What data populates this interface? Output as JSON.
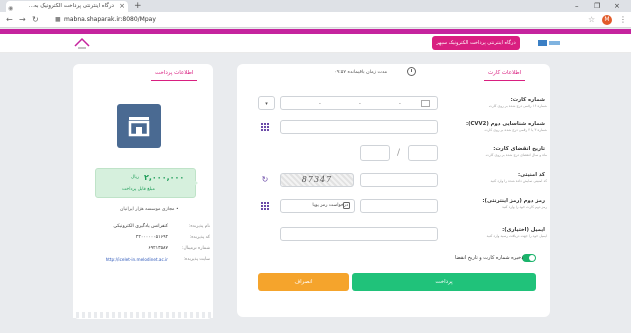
{
  "browser": {
    "tab_title": "درگاه اینترنتی پرداخت الکترونیک به...",
    "tab_close": "×",
    "new_tab": "+",
    "url": "mabna.shaparak.ir:8080/Mpay",
    "window_min": "–",
    "window_max": "❐",
    "window_close": "×",
    "profile_initial": "M"
  },
  "header": {
    "title": "درگاه اینترنتی پرداخت الکترونیک سپهر"
  },
  "card_panel": {
    "tab_label": "اطلاعات کارت",
    "timer_label": "مدت زمان باقیمانده",
    "timer_value": "۰۹:۵۷",
    "card_number": {
      "label": "شماره کارت:",
      "hint": "شماره ۱۶ رقمی درج شده بر روی کارت",
      "dash1": "-",
      "dash2": "-",
      "dash3": "-"
    },
    "cvv2": {
      "label": "شماره شناسایی دوم (CVV2):",
      "hint": "شماره ۳ یا ۴ رقمی درج شده بر روی کارت"
    },
    "expiry": {
      "label": "تاریخ انقضای کارت:",
      "hint": "ماه و سال انقضای درج شده بر روی کارت",
      "separator": "/"
    },
    "captcha": {
      "label": "کد امنیتی:",
      "hint": "کد امنیتی نمایش داده شده را وارد کنید",
      "code": "87347"
    },
    "password": {
      "label": "رمز دوم (رمز اینترنتی):",
      "hint": "رمز دوم کارت خود را وارد کنید",
      "request_button": "درخواست رمز پویا"
    },
    "email": {
      "label": "ایمیل (اختیاری):",
      "hint": "ایمیل خود را جهت دریافت رسید وارد کنید"
    },
    "save_label": "ذخیره شماره کارت و تاریخ انقضا",
    "pay_button": "پرداخت",
    "cancel_button": "انصراف"
  },
  "info_panel": {
    "tab_label": "اطلاعات پرداخت",
    "amount": "۲,۰۰۰,۰۰۰",
    "amount_unit": "ریال",
    "amount_label": "مبلغ قابل پرداخت",
    "detail_heading": "• مجازی موسسه هژار ایرانیان",
    "details": [
      {
        "label": "نام پذیرنده:",
        "value": "کنفرانس یادگیری الکترونیکی"
      },
      {
        "label": "کد پذیرنده:",
        "value": "۲۲۰۰۰۰۰۰۵۱۶۹۲"
      },
      {
        "label": "شماره ترمینال:",
        "value": "۶۹۲۱۳۵۸۷"
      },
      {
        "label": "سایت پذیرنده:",
        "value": "http://icelet-in.melodinet.ac.ir"
      }
    ]
  },
  "icons": {
    "keypad": "keypad-icon",
    "refresh": "refresh-icon",
    "calendar": "calendar-icon",
    "shop": "shop-icon",
    "clock": "clock-icon"
  },
  "colors": {
    "brand": "#d91f80",
    "pay": "#20c27a",
    "cancel": "#f5a42c",
    "amount_bg": "#d6f0dd"
  }
}
